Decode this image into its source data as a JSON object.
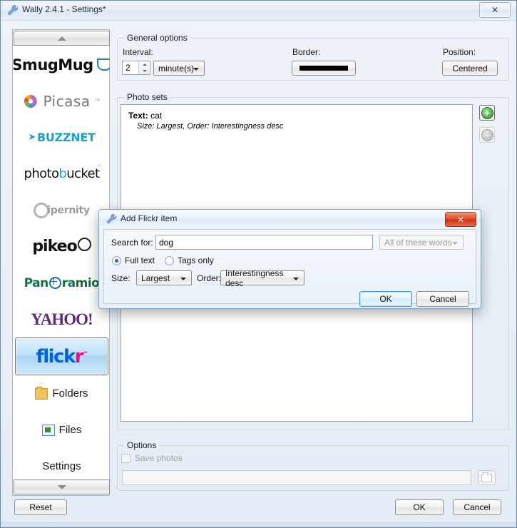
{
  "window": {
    "title": "Wally 2.4.1 - Settings*",
    "icon": "wrench-icon",
    "close_label": "✕"
  },
  "sidebar": {
    "scroll_up": "▲",
    "scroll_down": "▼",
    "items": [
      {
        "id": "smugmug",
        "label": "SmugMug",
        "selected": false
      },
      {
        "id": "picasa",
        "label": "Picasa",
        "selected": false
      },
      {
        "id": "buzznet",
        "label": "Buzznet",
        "selected": false
      },
      {
        "id": "photobucket",
        "label": "photobucket",
        "selected": false
      },
      {
        "id": "ipernity",
        "label": "ipernity",
        "selected": false
      },
      {
        "id": "pikeo",
        "label": "pikeo",
        "selected": false
      },
      {
        "id": "panoramio",
        "label": "Panoramio",
        "selected": false
      },
      {
        "id": "yahoo",
        "label": "YAHOO!",
        "selected": false
      },
      {
        "id": "flickr",
        "label": "flickr",
        "selected": true
      },
      {
        "id": "folders",
        "label": "Folders",
        "selected": false
      },
      {
        "id": "files",
        "label": "Files",
        "selected": false
      },
      {
        "id": "settings",
        "label": "Settings",
        "selected": false
      }
    ]
  },
  "general_options": {
    "title": "General options",
    "interval_label": "Interval:",
    "interval_value": "2",
    "interval_unit": "minute(s)",
    "border_label": "Border:",
    "position_label": "Position:",
    "position_value": "Centered"
  },
  "photo_sets": {
    "title": "Photo sets",
    "items": [
      {
        "text_label": "Text:",
        "text_value": "cat",
        "details": "Size: Largest,  Order: Interestingness desc"
      }
    ],
    "add_button": "+",
    "remove_button": "−"
  },
  "options": {
    "title": "Options",
    "save_photos_label": "Save photos",
    "save_photos_checked": false,
    "path_value": "",
    "browse_icon": "folder-icon"
  },
  "footer": {
    "reset": "Reset",
    "ok": "OK",
    "cancel": "Cancel"
  },
  "dialog": {
    "title": "Add Flickr item",
    "icon": "wrench-icon",
    "close_label": "✕",
    "search_label": "Search for:",
    "search_value": "dog",
    "match_mode": "All of these words",
    "radio_full_text": "Full text",
    "radio_tags_only": "Tags only",
    "radio_selected": "Full text",
    "size_label": "Size:",
    "size_value": "Largest",
    "order_label": "Order:",
    "order_value": "Interestingness desc",
    "ok": "OK",
    "cancel": "Cancel"
  },
  "colors": {
    "accent": "#1a6fc0",
    "selection": "#a8d6f3",
    "dialog_close": "#e4512a",
    "add_green": "#2f8f31"
  }
}
